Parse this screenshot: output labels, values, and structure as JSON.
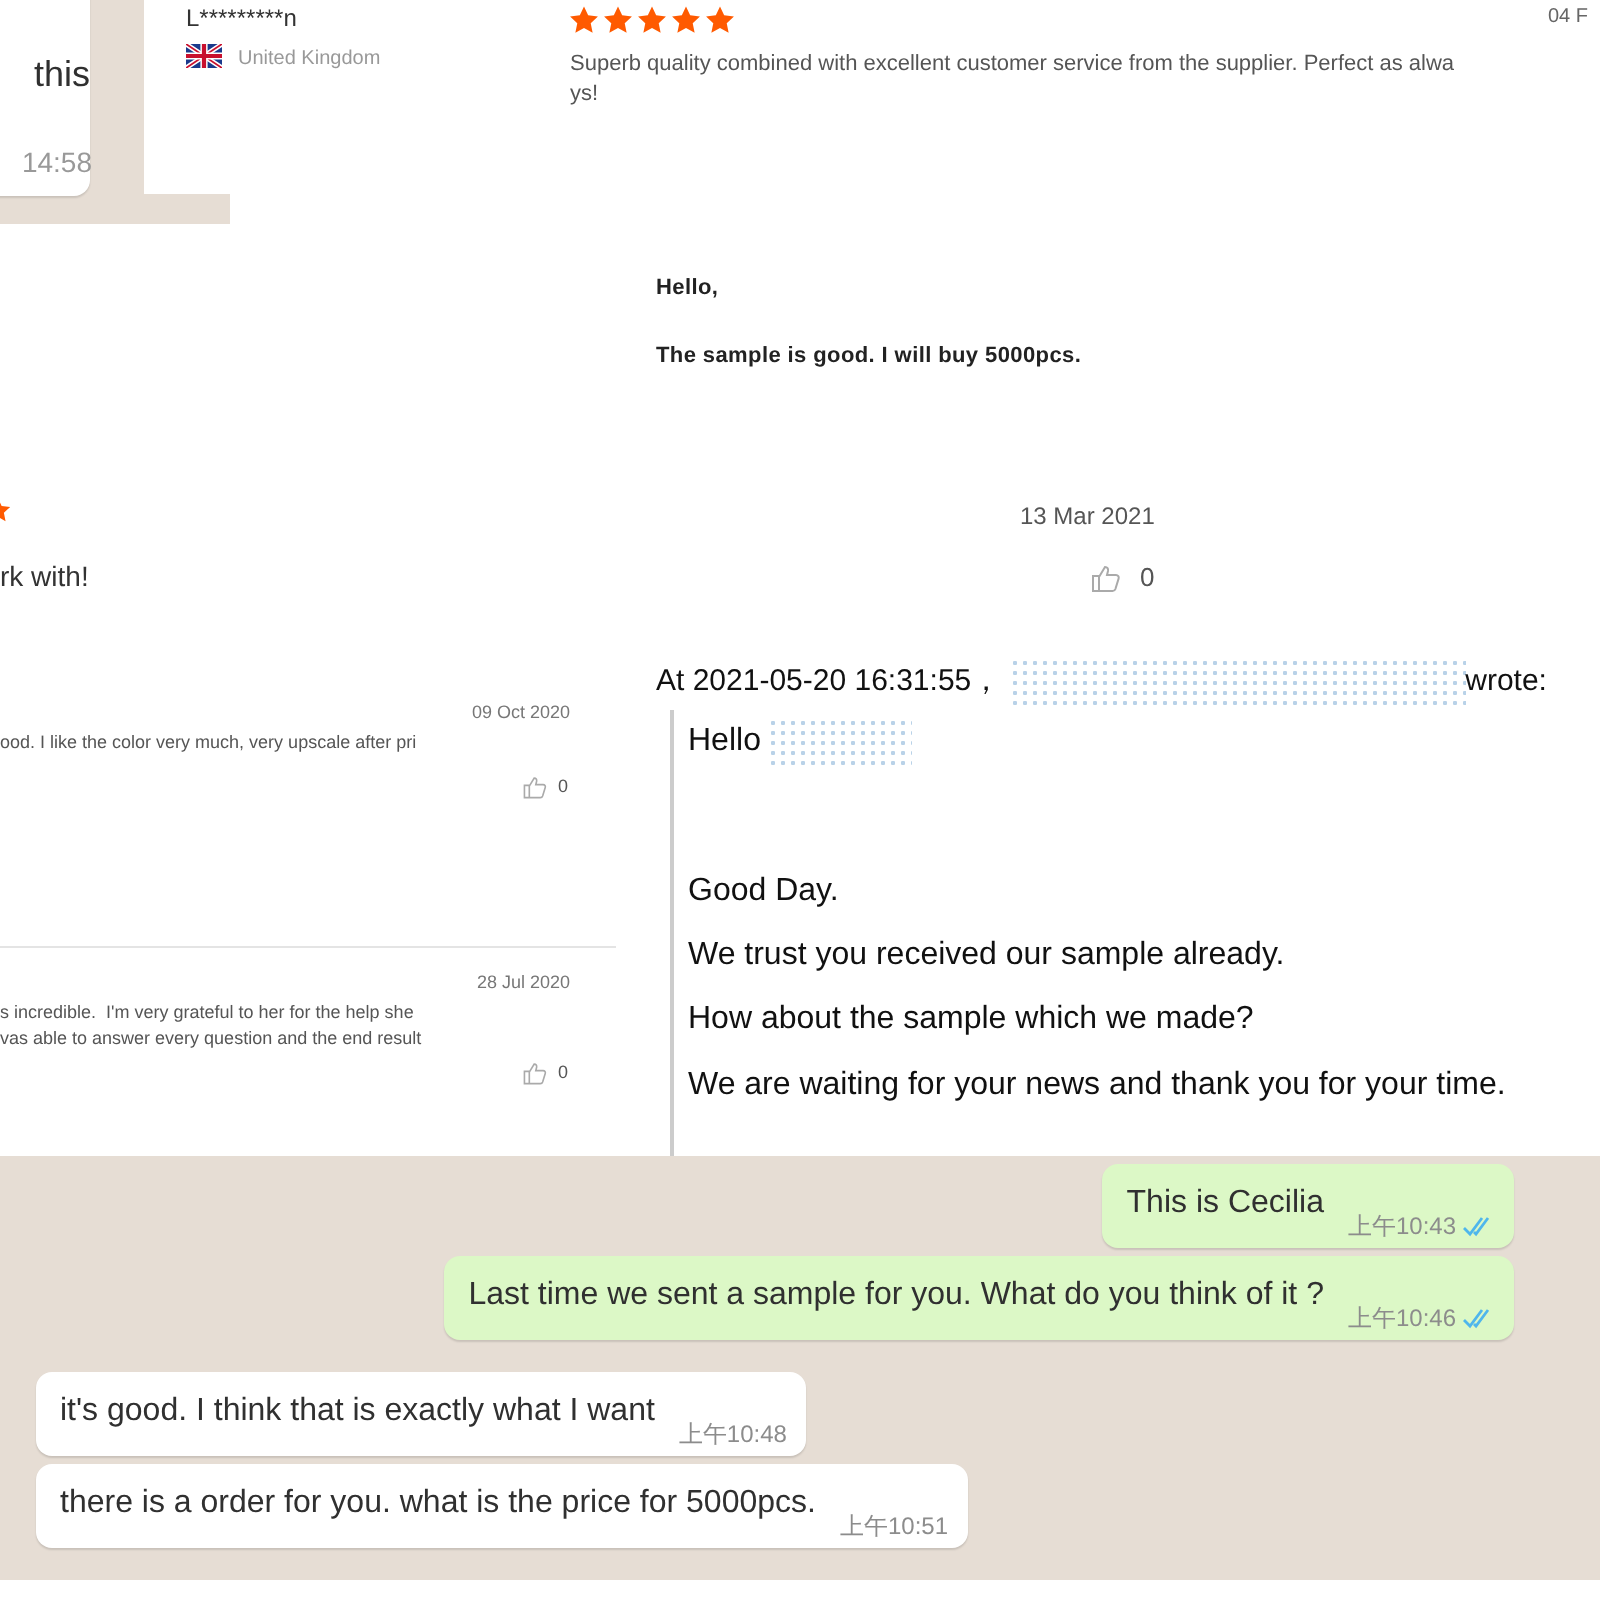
{
  "top_chat_bubble": {
    "text": "this",
    "time": "14:58"
  },
  "review_card": {
    "reviewer": "L*********n",
    "country": "United Kingdom",
    "stars": 5,
    "comment_lines": [
      "Superb quality combined with excellent customer service from the supplier. Perfect as alwa",
      "ys!"
    ],
    "date": "04 F"
  },
  "message_snippet": [
    "Hello,",
    "The sample is good. I will buy 5000pcs."
  ],
  "review_fragment": {
    "text": "rk with!",
    "date": "13 Mar 2021",
    "likes": "0"
  },
  "review_list": [
    {
      "date": "09 Oct 2020",
      "lines": [
        "ood. I like the color very much, very upscale after pri"
      ],
      "likes": "0"
    },
    {
      "date": "28 Jul 2020",
      "lines": [
        "s incredible.  I'm very grateful to her for the help she",
        "vas able to answer every question and the end result"
      ],
      "likes": "0"
    }
  ],
  "email_quote": {
    "header_prefix": "At 2021-05-20 16:31:55，",
    "header_suffix": "wrote:",
    "greeting": "Hello",
    "lines": [
      "Good Day.",
      "We trust you received our sample already.",
      "How about the sample which we made?",
      "We are waiting for your news and thank you for your time."
    ]
  },
  "chat_messages": [
    {
      "kind": "outgoing",
      "text": "This is Cecilia",
      "time": "上午10:43",
      "read": true
    },
    {
      "kind": "outgoing",
      "text": "Last time we sent a sample for you. What do you think of it ?",
      "time": "上午10:46",
      "read": true
    },
    {
      "kind": "incoming",
      "text": "it's good. I think that is exactly what I want",
      "time": "上午10:48"
    },
    {
      "kind": "incoming",
      "text": "there is a order for you. what is the price for 5000pcs.",
      "time": "上午10:51"
    }
  ]
}
